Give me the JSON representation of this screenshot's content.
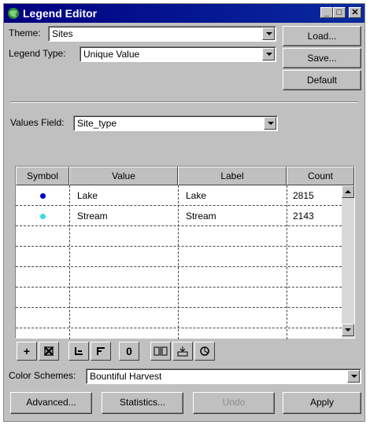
{
  "window": {
    "title": "Legend Editor"
  },
  "title_buttons": {
    "minimize": "_",
    "maximize": "□",
    "close": "✕"
  },
  "theme": {
    "label": "Theme:",
    "value": "Sites"
  },
  "legend_type": {
    "label": "Legend Type:",
    "value": "Unique Value"
  },
  "buttons": {
    "load": "Load...",
    "save": "Save...",
    "default": "Default"
  },
  "values_field": {
    "label": "Values Field:",
    "value": "Site_type"
  },
  "table": {
    "headers": [
      "Symbol",
      "Value",
      "Label",
      "Count"
    ],
    "rows": [
      {
        "symbol_color": "#0000cc",
        "value": "Lake",
        "label": "Lake",
        "count": "2815"
      },
      {
        "symbol_color": "#33dddd",
        "value": "Stream",
        "label": "Stream",
        "count": "2143"
      }
    ]
  },
  "toolbar_icons": [
    "plus-icon",
    "remove-icon",
    "sort-asc-icon",
    "sort-desc-icon",
    "null-value-icon",
    "move-up-icon",
    "move-down-icon",
    "properties-icon"
  ],
  "toolbar_glyphs": {
    "plus": "+",
    "null": "0"
  },
  "color_schemes": {
    "label": "Color Schemes:",
    "value": "Bountiful Harvest"
  },
  "footer_buttons": {
    "advanced": "Advanced...",
    "statistics": "Statistics...",
    "undo": "Undo",
    "apply": "Apply"
  }
}
